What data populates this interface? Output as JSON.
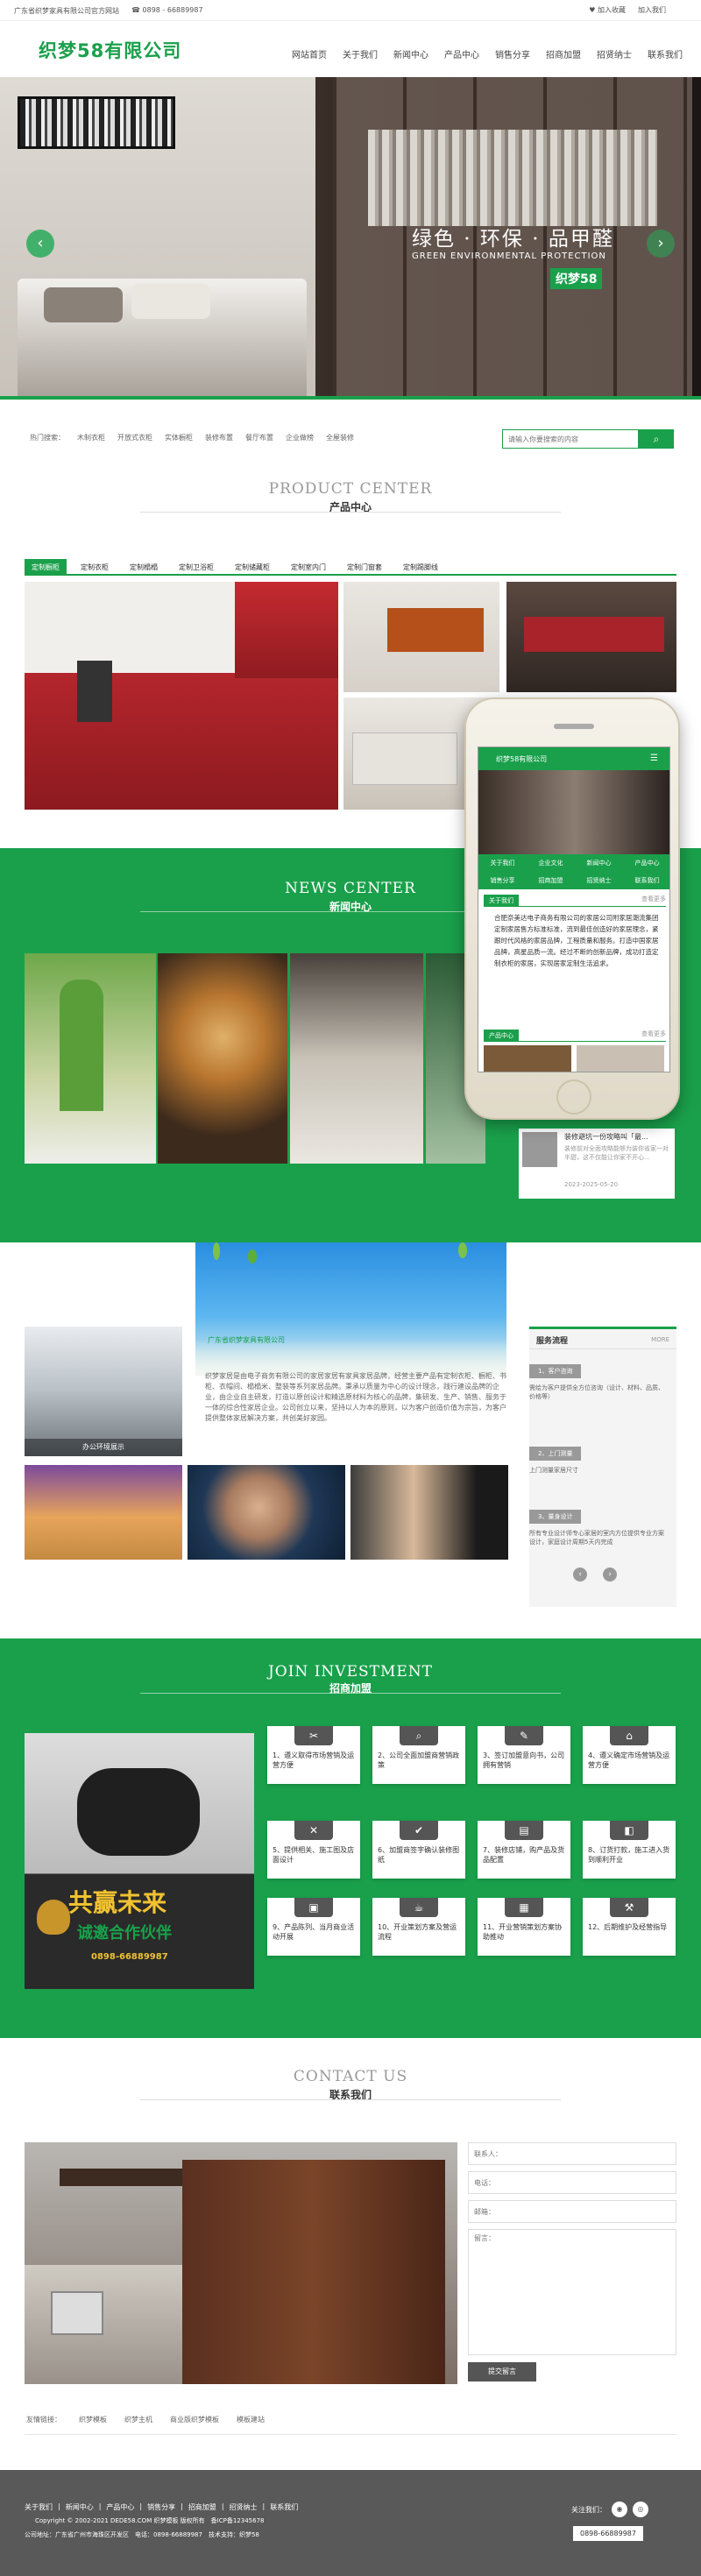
{
  "topbar": {
    "site_desc": "广东省织梦家具有限公司官方网站",
    "phone": "0898 - 66889987",
    "login": "加入收藏",
    "join": "加入我们"
  },
  "header": {
    "logo": "织梦58有限公司",
    "nav": [
      "网站首页",
      "关于我们",
      "新闻中心",
      "产品中心",
      "销售分享",
      "招商加盟",
      "招贤纳士",
      "联系我们"
    ]
  },
  "hero": {
    "slogan": "绿色 · 环保 · 品甲醛",
    "slogan_en": "GREEN ENVIRONMENTAL PROTECTION",
    "badge": "织梦58",
    "prev": "‹",
    "next": "›"
  },
  "search": {
    "hot_label": "热门搜索：",
    "hot": [
      "木制衣柜",
      "开放式衣柜",
      "实体橱柜",
      "装修布置",
      "餐厅布置",
      "企业做榜",
      "全屋装修"
    ],
    "placeholder": "请输入你要搜索的内容"
  },
  "product_center": {
    "title_en": "PRODUCT CENTER",
    "title_cn": "产品中心",
    "tabs": [
      "定制橱柜",
      "定制衣柜",
      "定制榻榻",
      "定制卫浴柜",
      "定制储藏柜",
      "定制室内门",
      "定制门窗套",
      "定制踢脚线"
    ]
  },
  "news_center": {
    "title_en": "NEWS CENTER",
    "title_cn": "新闻中心",
    "item_title": "装修避坑一份攻略叫「最...",
    "item_desc": "装修前对全面攻略能够为装你省家一对半甜，这不仅能让你家不开心...",
    "item_date": "2023-2025-05-20"
  },
  "phone_screen": {
    "header": "织梦58有限公司",
    "menu": [
      "关于我们",
      "企业文化",
      "新闻中心",
      "产品中心",
      "销售分享",
      "招商加盟",
      "招贤纳士",
      "联系我们"
    ],
    "about_label": "关于我们",
    "more": "查看更多",
    "about_text": "合肥奈美达电子商务有限公司的家居公司附家居潮流集团定制家居售方标准标准，流到最佳创造好的家居理念，紧跟时代风格的家居品牌，工程质量和服务。打造中国家居品牌，高星品质一流。经过不断的创新品牌，成功打造定制衣柜的家居，实现居家定制生活追求。",
    "product_label": "产品中心"
  },
  "company": {
    "banner_text": "广东省织梦家具有限公司",
    "text": "织梦家居是由电子商务有限公司的家居家居有家具家居品牌，经营主要产品有定制衣柜、橱柜、书柜、衣帽间、榻榻米、整装等系列家居品牌。秉承以质量为中心的设计理念，践行建设品牌的企业，由企业自主研发，打造以原创设计和精选原材料为核心的品牌，集研发、生产、销售、服务于一体的综合性家居企业。公司创立以来，坚持以人为本的原则，以为客户创造价值为宗旨，为客户提供整体家居解决方案，共创美好家园。",
    "office_label": "办公环境展示",
    "service_title": "服务流程",
    "service_more": "MORE",
    "steps": [
      {
        "label": "1、客户咨询",
        "text": "需给为客户提供全方位咨询（设计、材料、品质、价格等）"
      },
      {
        "label": "2、上门测量",
        "text": "上门测量家居尺寸"
      },
      {
        "label": "3、量身设计",
        "text": "所有专业设计师专心家居的室内方位提供专业方案设计，家庭设计周期5天内完成"
      }
    ]
  },
  "join": {
    "title_en": "JOIN INVESTMENT",
    "title_cn": "招商加盟",
    "promo_big": "共赢未来",
    "promo_sub": "诚邀合作伙伴",
    "promo_phone": "0898-66889987",
    "items": [
      {
        "icon": "scissors",
        "text": "1、遵义取得市场营销及运营方便"
      },
      {
        "icon": "search",
        "text": "2、公司全面加盟商营销政策"
      },
      {
        "icon": "pen",
        "text": "3、签订加盟意向书，公司拥有营销"
      },
      {
        "icon": "store",
        "text": "4、遵义确定市场营销及运营方便"
      },
      {
        "icon": "tools",
        "text": "5、提供相关、施工图及店面设计"
      },
      {
        "icon": "check",
        "text": "6、加盟商签字确认装修图纸"
      },
      {
        "icon": "register",
        "text": "7、装修店铺，购产品及货品配置"
      },
      {
        "icon": "cart",
        "text": "8、订货打款，施工进入货到顺利开业"
      },
      {
        "icon": "gift",
        "text": "9、产品陈列、当月商业活动开展"
      },
      {
        "icon": "cup",
        "text": "10、开业策划方案及营运流程"
      },
      {
        "icon": "ticket",
        "text": "11、开业营销策划方案协助推动"
      },
      {
        "icon": "wrench",
        "text": "12、后期维护及经营指导"
      }
    ]
  },
  "contact": {
    "title_en": "CONTACT US",
    "title_cn": "联系我们",
    "name_ph": "联系人：",
    "phone_ph": "电话：",
    "email_ph": "邮箱：",
    "content_ph": "留言：",
    "submit": "提交留言"
  },
  "links": {
    "label": "友情链接：",
    "items": [
      "织梦模板",
      "织梦主机",
      "商业版织梦模板",
      "模板建站"
    ]
  },
  "footer": {
    "nav": [
      "关于我们",
      "新闻中心",
      "产品中心",
      "销售分享",
      "招商加盟",
      "招贤纳士",
      "联系我们"
    ],
    "copyright": "Copyright © 2002-2021 DEDE58.COM 织梦模板 版权所有　备ICP备12345678",
    "address": "公司地址：广东省广州市海珠区开发区　电话：0898-66889987　技术支持：织梦58",
    "qr_label": "关注我们：",
    "btn": "0898-66889987"
  },
  "colors": {
    "brand_green": "#1aa04b",
    "footer_gray": "#595959"
  }
}
